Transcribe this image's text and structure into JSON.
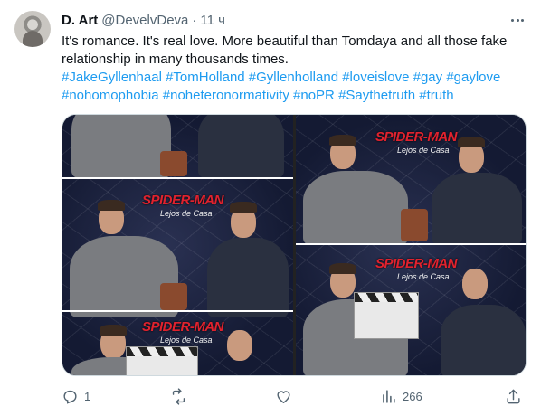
{
  "author": {
    "display_name": "D. Art",
    "handle": "@DevelvDeva",
    "separator": "·",
    "time": "11 ч"
  },
  "tweet": {
    "text": "It's romance. It's real love. More beautiful than Tomdaya and all those fake relationship in many thousands times.",
    "hashtags_line1": [
      "#JakeGyllenhaal",
      "#TomHolland",
      "#Gyllenholland",
      "#loveislove",
      "#gay",
      "#gaylove"
    ],
    "hashtags_line2": [
      "#nohomophobia",
      "#noheteronormativity",
      "#noPR",
      "#Saythetruth",
      "#truth"
    ]
  },
  "media": {
    "logo_text": "SPIDER-MAN",
    "logo_subtitle": "Lejos de Casa"
  },
  "actions": {
    "reply_count": "1",
    "retweet_count": "",
    "like_count": "",
    "views_count": "266"
  },
  "colors": {
    "accent": "#1d9bf0",
    "muted": "#536471",
    "text": "#0f1419"
  }
}
